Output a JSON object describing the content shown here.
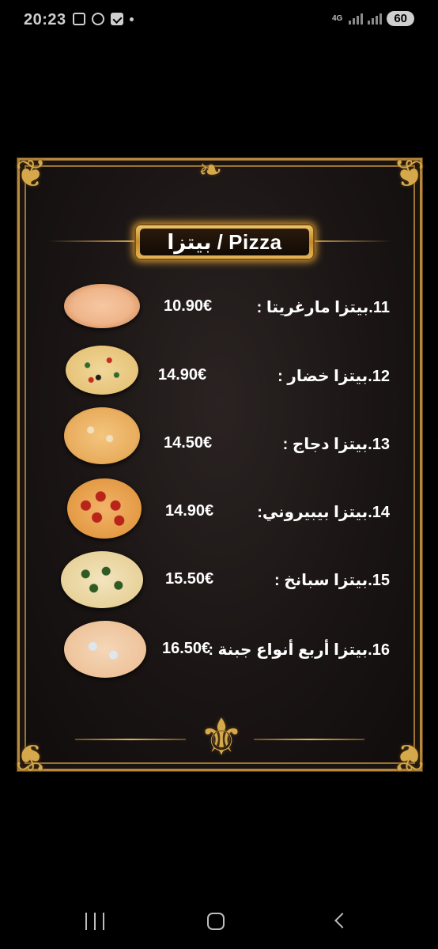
{
  "status_bar": {
    "time": "20:23",
    "network": "4G",
    "battery": "60",
    "icons": [
      "screenshot-icon",
      "fan-icon",
      "checkbox-icon",
      "dot-icon"
    ]
  },
  "menu": {
    "title": "بيتزا / Pizza",
    "items": [
      {
        "name": "11.بيتزا مارغريتا :",
        "price": "10.90€",
        "image": "pizza-margherita"
      },
      {
        "name": "12.بيتزا خضار :",
        "price": "14.90€",
        "image": "pizza-vegetable"
      },
      {
        "name": "13.بيتزا دجاج :",
        "price": "14.50€",
        "image": "pizza-chicken"
      },
      {
        "name": "14.بيتزا بيبيروني:",
        "price": "14.90€",
        "image": "pizza-pepperoni"
      },
      {
        "name": "15.بيتزا سبانخ :",
        "price": "15.50€",
        "image": "pizza-spinach"
      },
      {
        "name": "16.بيتزا أربع أنواع جبنة :",
        "price": "16.50€",
        "image": "pizza-four-cheese"
      }
    ]
  },
  "nav_bar": {
    "buttons": [
      "recents-icon",
      "home-icon",
      "back-icon"
    ]
  }
}
